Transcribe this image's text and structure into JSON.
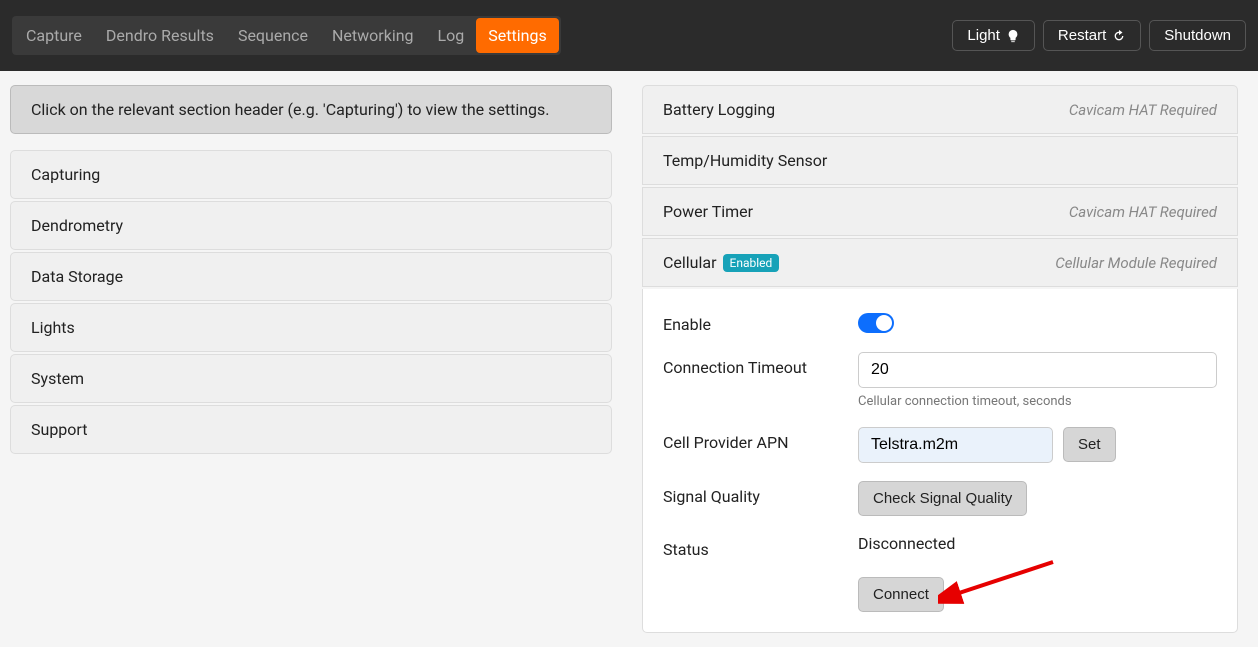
{
  "nav": {
    "items": [
      "Capture",
      "Dendro Results",
      "Sequence",
      "Networking",
      "Log",
      "Settings"
    ],
    "active": "Settings",
    "buttons": {
      "light": "Light",
      "restart": "Restart",
      "shutdown": "Shutdown"
    }
  },
  "left": {
    "info": "Click on the relevant section header (e.g. 'Capturing') to view the settings.",
    "sections": [
      "Capturing",
      "Dendrometry",
      "Data Storage",
      "Lights",
      "System",
      "Support"
    ]
  },
  "right": {
    "panels": [
      {
        "title": "Battery Logging",
        "note": "Cavicam HAT Required"
      },
      {
        "title": "Temp/Humidity Sensor",
        "note": ""
      },
      {
        "title": "Power Timer",
        "note": "Cavicam HAT Required"
      },
      {
        "title": "Cellular",
        "badge": "Enabled",
        "note": "Cellular Module Required"
      }
    ]
  },
  "cellular": {
    "enable_label": "Enable",
    "enable_value": true,
    "timeout_label": "Connection Timeout",
    "timeout_value": "20",
    "timeout_help": "Cellular connection timeout, seconds",
    "apn_label": "Cell Provider APN",
    "apn_value": "Telstra.m2m",
    "set_btn": "Set",
    "signal_label": "Signal Quality",
    "signal_btn": "Check Signal Quality",
    "status_label": "Status",
    "status_value": "Disconnected",
    "connect_btn": "Connect"
  }
}
